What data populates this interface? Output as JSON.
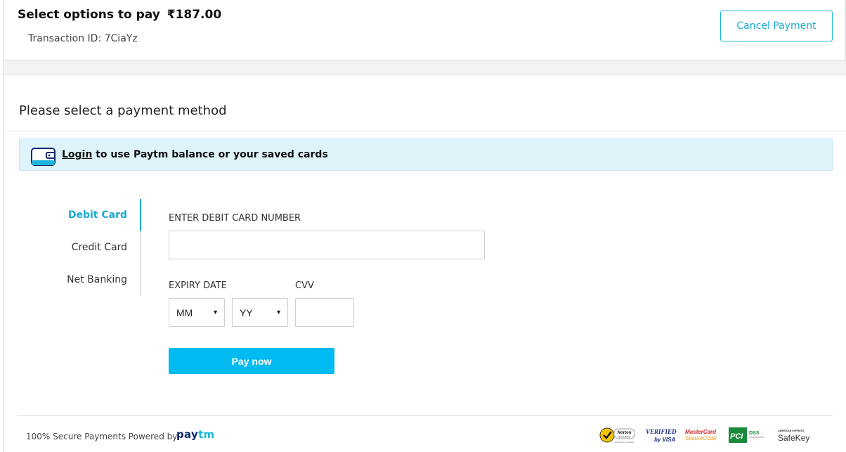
{
  "header": {
    "title": "Select options to pay",
    "currency_symbol": "₹",
    "amount": "187.00",
    "transaction_label": "Transaction ID: 7CiaYz",
    "cancel_label": "Cancel Payment"
  },
  "panel": {
    "title": "Please select a payment method"
  },
  "login_bar": {
    "icon": "wallet-icon",
    "link": "Login",
    "text": " to use Paytm balance or your saved cards"
  },
  "methods": [
    {
      "label": "Debit Card",
      "active": true
    },
    {
      "label": "Credit Card",
      "active": false
    },
    {
      "label": "Net Banking",
      "active": false
    }
  ],
  "form": {
    "card_label": "ENTER DEBIT CARD NUMBER",
    "card_value": "",
    "expiry_label": "EXPIRY DATE",
    "cvv_label": "CVV",
    "month_value": "MM",
    "year_value": "YY",
    "pay_label": "Pay now"
  },
  "footer": {
    "secure_text": "100% Secure Payments Powered by",
    "brand_pay": "pay",
    "brand_tm": "tm",
    "badges": {
      "norton": {
        "line1": "Norton",
        "line2": "SECURED",
        "line3": "powered by VeriSign"
      },
      "visa": {
        "line1": "VERIFIED",
        "line2": "by VISA"
      },
      "mastercard": {
        "line1": "MasterCard",
        "line2": "SecureCode"
      },
      "pci": {
        "line1": "PCI",
        "line2": "DSS"
      },
      "amex": {
        "line1": "AMERICAN EXPRESS",
        "line2": "SafeKey"
      }
    }
  },
  "colors": {
    "accent": "#1aa9d1",
    "pay_button": "#00baf2",
    "login_bar_bg": "#dff3fb"
  }
}
